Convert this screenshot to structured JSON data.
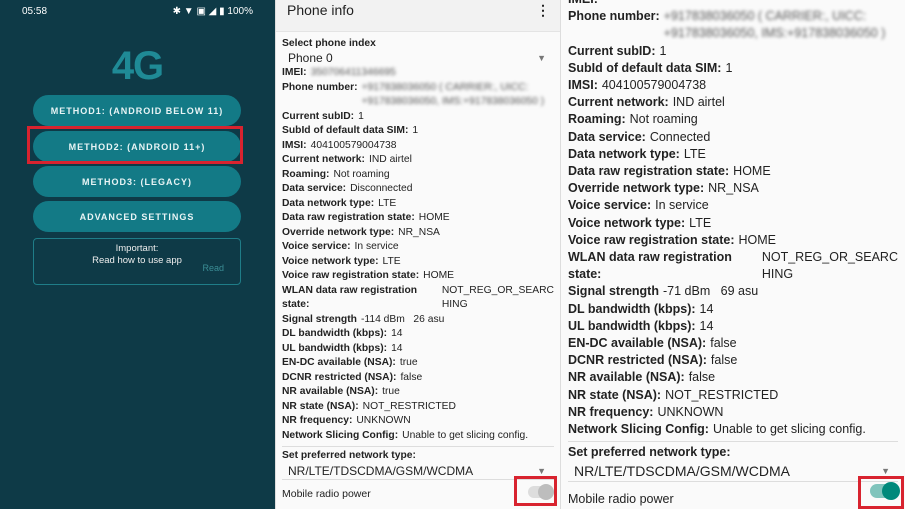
{
  "app": {
    "status": {
      "time": "05:58",
      "icons": "✱ ▼ ▣ ◢ ▮",
      "battery": "100%"
    },
    "logo": "4G",
    "buttons": [
      "METHOD1: (ANDROID BELOW 11)",
      "METHOD2: (ANDROID 11+)",
      "METHOD3: (LEGACY)",
      "ADVANCED SETTINGS"
    ],
    "important": {
      "title": "Important:",
      "text": "Read how to use app",
      "link": "Read"
    }
  },
  "phone_info_1": {
    "title": "Phone info",
    "select_label": "Select phone index",
    "select_value": "Phone 0",
    "rows": [
      [
        "IMEI:",
        "350706411346695",
        true
      ],
      [
        "Phone number:",
        "+917838036050 ( CARRIER:, UICC:\n+917838036050, IMS:+917838036050 )",
        true
      ],
      [
        "Current subID:",
        "1"
      ],
      [
        "SubId of default data SIM:",
        "1"
      ],
      [
        "IMSI:",
        "404100579004738"
      ],
      [
        "Current network:",
        "IND airtel"
      ],
      [
        "Roaming:",
        "Not roaming"
      ],
      [
        "Data service:",
        "Disconnected"
      ],
      [
        "Data network type:",
        "LTE"
      ],
      [
        "Data raw registration state:",
        "HOME"
      ],
      [
        "Override network type:",
        "NR_NSA"
      ],
      [
        "Voice service:",
        "In service"
      ],
      [
        "Voice network type:",
        "LTE"
      ],
      [
        "Voice raw registration state:",
        "HOME"
      ],
      [
        "WLAN data raw registration state:",
        "NOT_REG_OR_SEARC\nHING"
      ],
      [
        "Signal strength",
        "-114 dBm   26 asu"
      ],
      [
        "DL bandwidth (kbps):",
        "14"
      ],
      [
        "UL bandwidth (kbps):",
        "14"
      ],
      [
        "EN-DC available (NSA):",
        "true"
      ],
      [
        "DCNR restricted (NSA):",
        "false"
      ],
      [
        "NR available (NSA):",
        "true"
      ],
      [
        "NR state (NSA):",
        "NOT_RESTRICTED"
      ],
      [
        "NR frequency:",
        "UNKNOWN"
      ],
      [
        "Network Slicing Config:",
        "Unable to get slicing config."
      ]
    ],
    "pref_label": "Set preferred network type:",
    "pref_value": "NR/LTE/TDSCDMA/GSM/WCDMA",
    "radio_label": "Mobile radio power",
    "radio_on": false
  },
  "phone_info_2": {
    "rows": [
      [
        "IMEI:",
        "",
        true
      ],
      [
        "Phone number:",
        "+917838036050 ( CARRIER:, UICC:\n+917838036050, IMS:+917838036050 )",
        true
      ],
      [
        "Current subID:",
        "1"
      ],
      [
        "SubId of default data SIM:",
        "1"
      ],
      [
        "IMSI:",
        "404100579004738"
      ],
      [
        "Current network:",
        "IND airtel"
      ],
      [
        "Roaming:",
        "Not roaming"
      ],
      [
        "Data service:",
        "Connected"
      ],
      [
        "Data network type:",
        "LTE"
      ],
      [
        "Data raw registration state:",
        "HOME"
      ],
      [
        "Override network type:",
        "NR_NSA"
      ],
      [
        "Voice service:",
        "In service"
      ],
      [
        "Voice network type:",
        "LTE"
      ],
      [
        "Voice raw registration state:",
        "HOME"
      ],
      [
        "WLAN data raw registration state:",
        "NOT_REG_OR_SEARC\nHING"
      ],
      [
        "Signal strength",
        "-71 dBm   69 asu"
      ],
      [
        "DL bandwidth (kbps):",
        "14"
      ],
      [
        "UL bandwidth (kbps):",
        "14"
      ],
      [
        "EN-DC available (NSA):",
        "false"
      ],
      [
        "DCNR restricted (NSA):",
        "false"
      ],
      [
        "NR available (NSA):",
        "false"
      ],
      [
        "NR state (NSA):",
        "NOT_RESTRICTED"
      ],
      [
        "NR frequency:",
        "UNKNOWN"
      ],
      [
        "Network Slicing Config:",
        "Unable to get slicing config."
      ]
    ],
    "pref_label": "Set preferred network type:",
    "pref_value": "NR/LTE/TDSCDMA/GSM/WCDMA",
    "radio_label": "Mobile radio power",
    "radio_on": true
  },
  "colors": {
    "highlight": "#d8232f",
    "accent": "#00897b",
    "app_bg": "#0e3a47",
    "button": "#137a86"
  }
}
